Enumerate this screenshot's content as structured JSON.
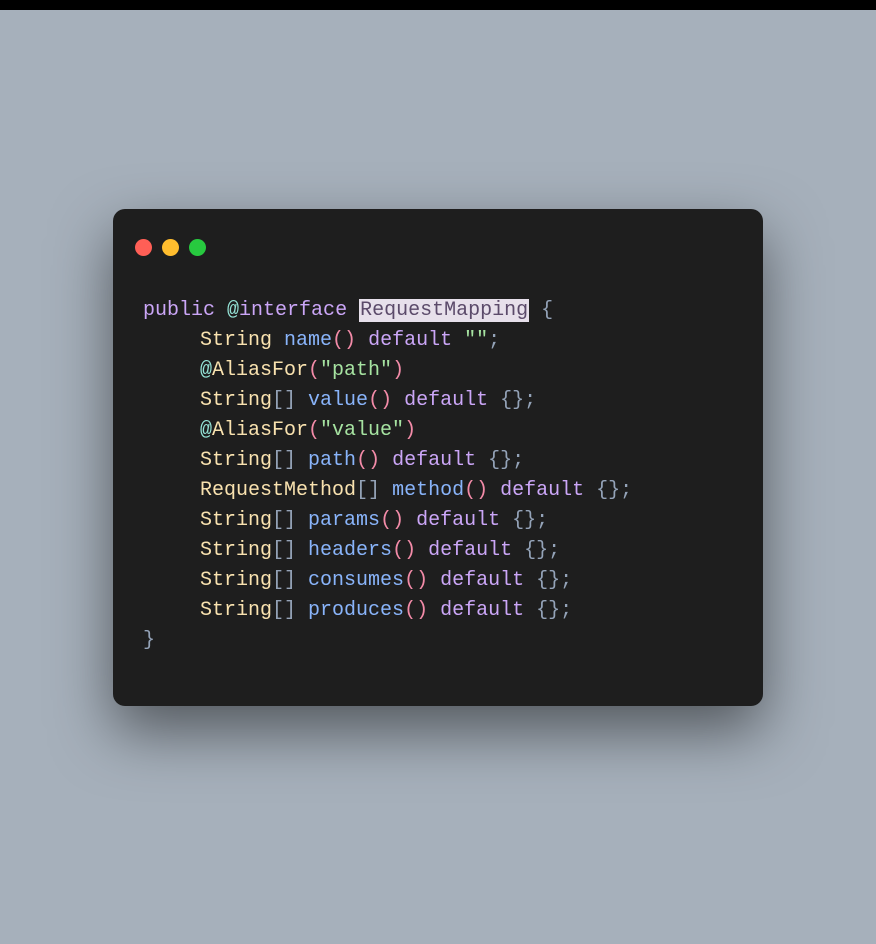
{
  "code": {
    "keywords": {
      "public": "public",
      "interface": "interface",
      "default": "default"
    },
    "types": {
      "String": "String",
      "RequestMethod": "RequestMethod"
    },
    "className": "RequestMapping",
    "annotations": {
      "AliasFor": "AliasFor"
    },
    "methods": {
      "name": "name",
      "value": "value",
      "path": "path",
      "method": "method",
      "params": "params",
      "headers": "headers",
      "consumes": "consumes",
      "produces": "produces"
    },
    "strings": {
      "empty": "\"\"",
      "path": "\"path\"",
      "value": "\"value\""
    },
    "symbols": {
      "at": "@",
      "openBrace": " {",
      "closeBrace": "}",
      "brackets": "[]",
      "parens": "()",
      "emptyBraces": " {}",
      "semicolon": ";",
      "space": " "
    }
  }
}
